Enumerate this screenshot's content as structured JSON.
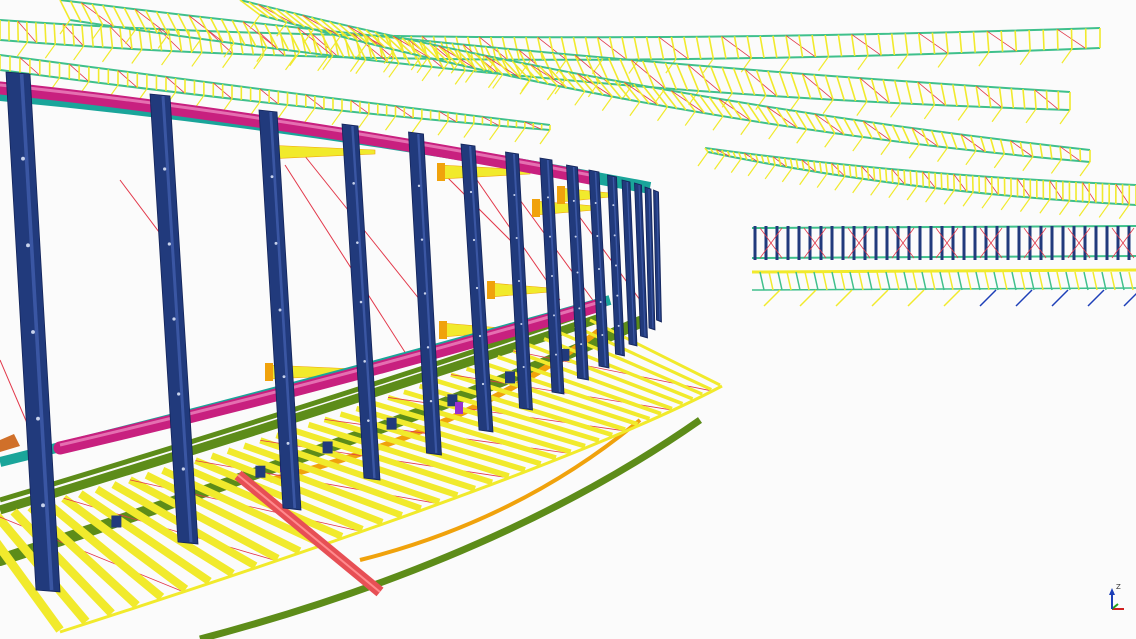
{
  "viewer": {
    "background": "#fbfbfb",
    "axis_labels": {
      "x": "",
      "y": "",
      "z": "Z"
    }
  },
  "colors": {
    "column": "#213a7c",
    "pipe_magenta": "#c8207f",
    "pipe_teal": "#1aa59a",
    "beam_green": "#5d8c19",
    "beam_yellow": "#f1ea2c",
    "beam_orange": "#f0a20c",
    "beam_red": "#e74f55",
    "bracing_red": "#e2384a",
    "truss_green": "#3fc08c",
    "axis_x": "#d02020",
    "axis_y": "#20a020",
    "axis_z": "#1d3fb8"
  }
}
